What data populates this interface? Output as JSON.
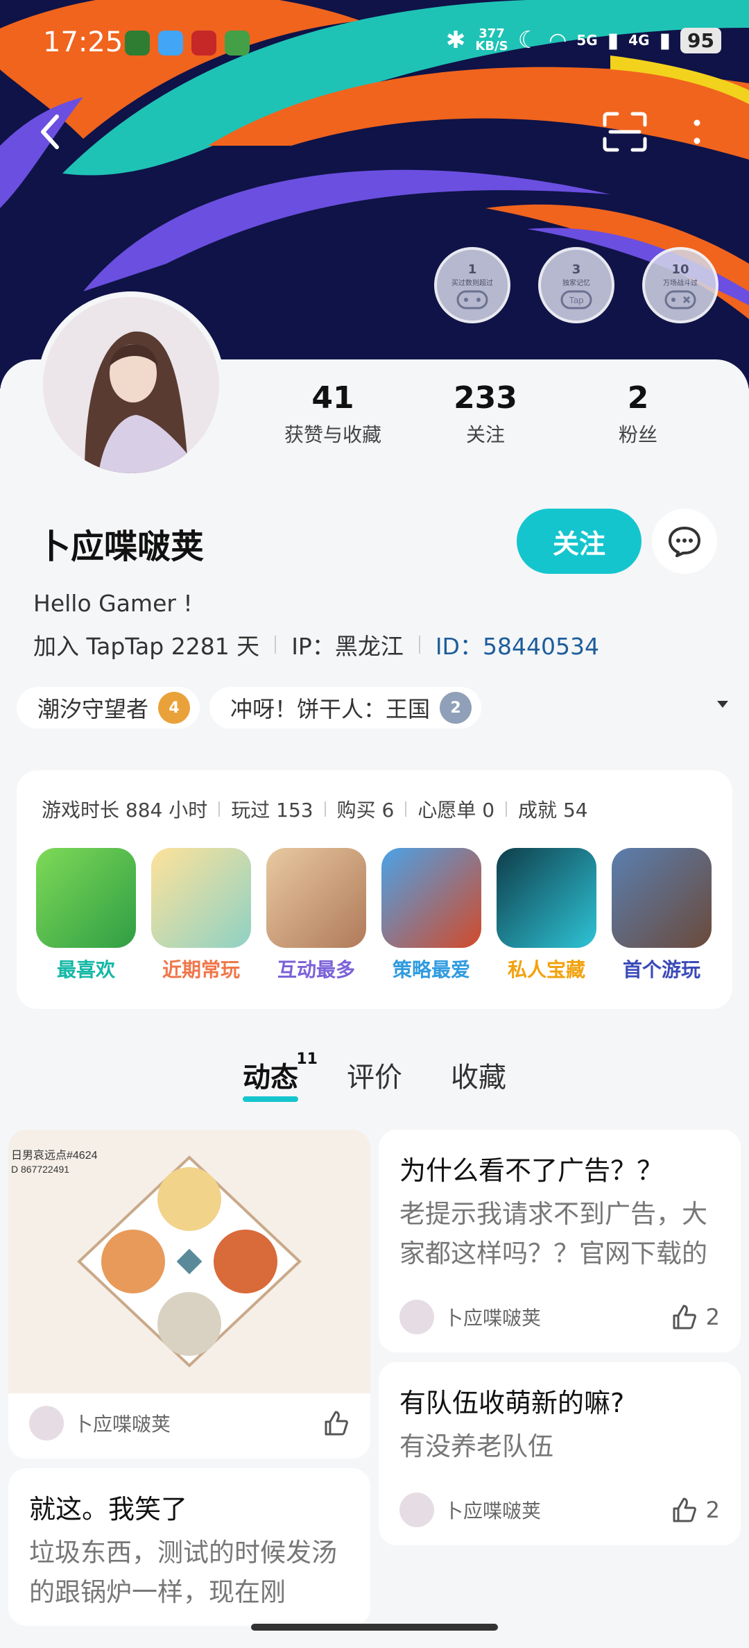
{
  "status_bar": {
    "time": "17:25",
    "speed_value": "377",
    "speed_unit": "KB/S",
    "network_1": "5G",
    "network_2": "4G",
    "battery": "95"
  },
  "badges": [
    {
      "num": "1",
      "caption": "买过数则超过"
    },
    {
      "num": "3",
      "caption": "独家记忆"
    },
    {
      "num": "10",
      "caption": "万场战斗过"
    }
  ],
  "profile": {
    "stats": [
      {
        "value": "41",
        "label": "获赞与收藏"
      },
      {
        "value": "233",
        "label": "关注"
      },
      {
        "value": "2",
        "label": "粉丝"
      }
    ],
    "username": "卜应喋啵荚",
    "follow_label": "关注",
    "bio": "Hello Gamer !",
    "joined": "加入 TapTap 2281 天",
    "ip": "IP：黑龙江",
    "id": "ID：58440534"
  },
  "tags": [
    {
      "label": "潮汐守望者",
      "level": "4",
      "color": "#e9a23a"
    },
    {
      "label": "冲呀！饼干人：王国",
      "level": "2",
      "color": "#8fa0b8"
    }
  ],
  "games": {
    "stats": [
      "游戏时长 884 小时",
      "玩过 153",
      "购买 6",
      "心愿单 0",
      "成就 54"
    ],
    "items": [
      {
        "label": "最喜欢",
        "color": "#14b8a6"
      },
      {
        "label": "近期常玩",
        "color": "#f0764a"
      },
      {
        "label": "互动最多",
        "color": "#7b61d9"
      },
      {
        "label": "策略最爱",
        "color": "#2f9be0"
      },
      {
        "label": "私人宝藏",
        "color": "#f2a20e"
      },
      {
        "label": "首个游玩",
        "color": "#3a4ab8"
      }
    ]
  },
  "tabs": [
    {
      "label": "动态",
      "count": "11"
    },
    {
      "label": "评价"
    },
    {
      "label": "收藏"
    }
  ],
  "posts": {
    "left": [
      {
        "image_text_1": "日男哀远点#4624",
        "image_text_2": "D 867722491",
        "author": "卜应喋啵荚"
      },
      {
        "title": "就这。我笑了",
        "text": "垃圾东西，测试的时候发汤的跟锅炉一样，现在刚"
      }
    ],
    "right": [
      {
        "title": "为什么看不了广告？？",
        "text": "老提示我请求不到广告，大家都这样吗？？官网下载的",
        "author": "卜应喋啵荚",
        "likes": "2"
      },
      {
        "title": "有队伍收萌新的嘛?",
        "text": "有没养老队伍",
        "author": "卜应喋啵荚",
        "likes": "2"
      }
    ]
  }
}
